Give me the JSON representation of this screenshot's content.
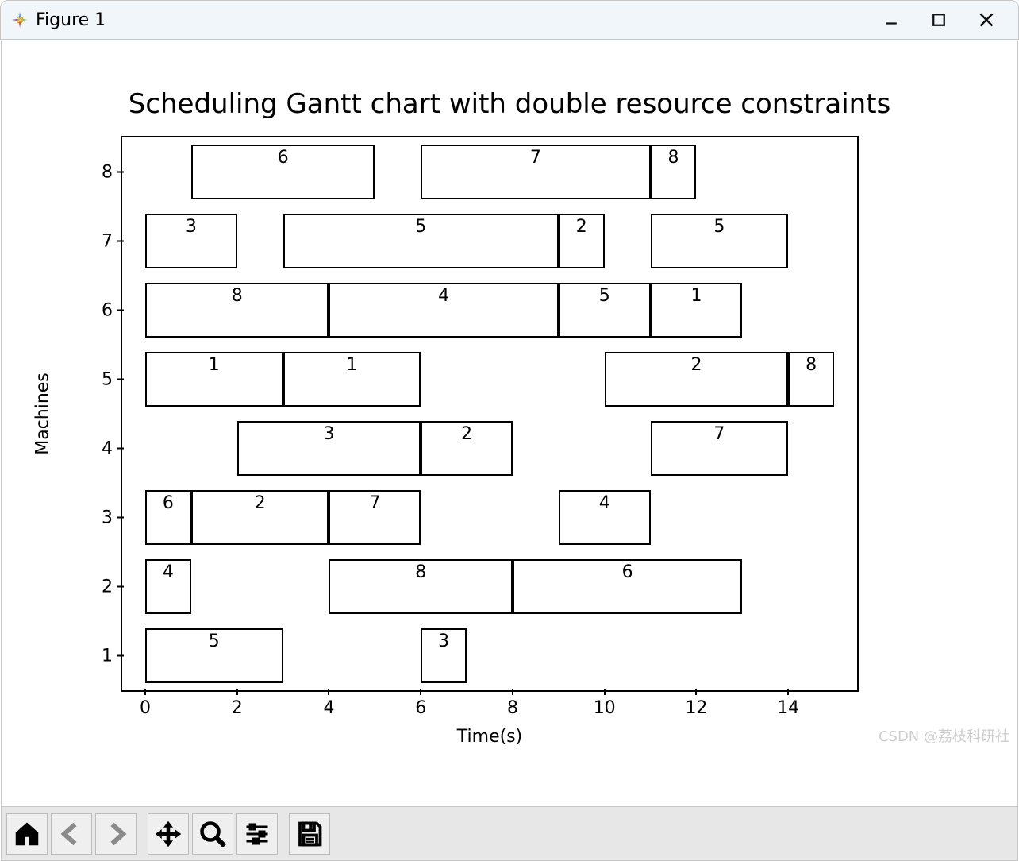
{
  "window": {
    "title": "Figure 1"
  },
  "chart_data": {
    "type": "gantt",
    "title": "Scheduling Gantt chart with double resource constraints",
    "xlabel": "Time(s)",
    "ylabel": "Machines",
    "xlim": [
      -0.5,
      15.5
    ],
    "ylim": [
      0.5,
      8.5
    ],
    "xticks": [
      0,
      2,
      4,
      6,
      8,
      10,
      12,
      14
    ],
    "yticks": [
      1,
      2,
      3,
      4,
      5,
      6,
      7,
      8
    ],
    "bar_height": 0.8,
    "tasks": [
      {
        "machine": 1,
        "start": 0,
        "end": 3,
        "label": "5"
      },
      {
        "machine": 1,
        "start": 6,
        "end": 7,
        "label": "3"
      },
      {
        "machine": 2,
        "start": 0,
        "end": 1,
        "label": "4"
      },
      {
        "machine": 2,
        "start": 4,
        "end": 8,
        "label": "8"
      },
      {
        "machine": 2,
        "start": 8,
        "end": 13,
        "label": "6"
      },
      {
        "machine": 3,
        "start": 0,
        "end": 1,
        "label": "6"
      },
      {
        "machine": 3,
        "start": 1,
        "end": 4,
        "label": "2"
      },
      {
        "machine": 3,
        "start": 4,
        "end": 6,
        "label": "7"
      },
      {
        "machine": 3,
        "start": 9,
        "end": 11,
        "label": "4"
      },
      {
        "machine": 4,
        "start": 2,
        "end": 6,
        "label": "3"
      },
      {
        "machine": 4,
        "start": 6,
        "end": 8,
        "label": "2"
      },
      {
        "machine": 4,
        "start": 11,
        "end": 14,
        "label": "7"
      },
      {
        "machine": 5,
        "start": 0,
        "end": 3,
        "label": "1"
      },
      {
        "machine": 5,
        "start": 3,
        "end": 6,
        "label": "1"
      },
      {
        "machine": 5,
        "start": 10,
        "end": 14,
        "label": "2"
      },
      {
        "machine": 5,
        "start": 14,
        "end": 15,
        "label": "8"
      },
      {
        "machine": 6,
        "start": 0,
        "end": 4,
        "label": "8"
      },
      {
        "machine": 6,
        "start": 4,
        "end": 9,
        "label": "4"
      },
      {
        "machine": 6,
        "start": 9,
        "end": 11,
        "label": "5"
      },
      {
        "machine": 6,
        "start": 11,
        "end": 13,
        "label": "1"
      },
      {
        "machine": 7,
        "start": 0,
        "end": 2,
        "label": "3"
      },
      {
        "machine": 7,
        "start": 3,
        "end": 9,
        "label": "5"
      },
      {
        "machine": 7,
        "start": 9,
        "end": 10,
        "label": "2"
      },
      {
        "machine": 7,
        "start": 11,
        "end": 14,
        "label": "5"
      },
      {
        "machine": 8,
        "start": 1,
        "end": 5,
        "label": "6"
      },
      {
        "machine": 8,
        "start": 6,
        "end": 11,
        "label": "7"
      },
      {
        "machine": 8,
        "start": 11,
        "end": 12,
        "label": "8"
      }
    ]
  },
  "toolbar": {
    "home": "Home",
    "back": "Back",
    "forward": "Forward",
    "pan": "Pan",
    "zoom": "Zoom",
    "configure": "Configure subplots",
    "save": "Save"
  },
  "watermark": "CSDN @荔枝科研社"
}
